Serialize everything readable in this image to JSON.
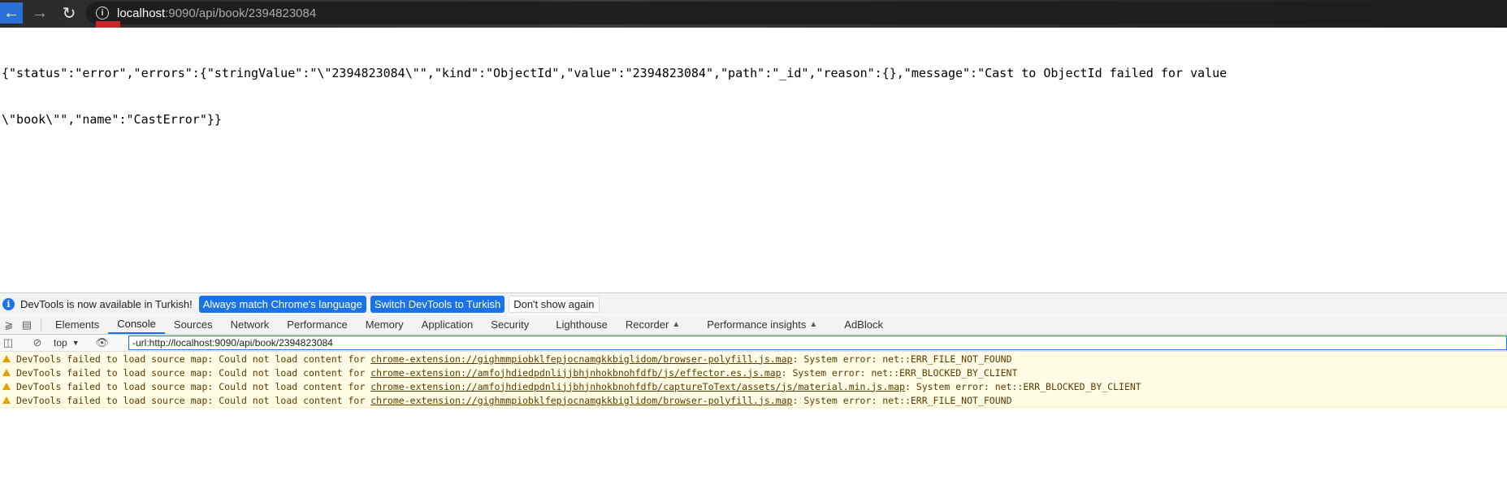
{
  "browser": {
    "url_host": "localhost",
    "url_rest": ":9090/api/book/2394823084"
  },
  "page": {
    "json_line1": "{\"status\":\"error\",\"errors\":{\"stringValue\":\"\\\"2394823084\\\"\",\"kind\":\"ObjectId\",\"value\":\"2394823084\",\"path\":\"_id\",\"reason\":{},\"message\":\"Cast to ObjectId failed for value",
    "json_line2": "\\\"book\\\"\",\"name\":\"CastError\"}}"
  },
  "devtools": {
    "infobar": {
      "message": "DevTools is now available in Turkish!",
      "match_button": "Always match Chrome's language",
      "switch_button": "Switch DevTools to Turkish",
      "dismiss_button": "Don't show again"
    },
    "tabs": [
      "Elements",
      "Console",
      "Sources",
      "Network",
      "Performance",
      "Memory",
      "Application",
      "Security",
      "Lighthouse",
      "Recorder",
      "Performance insights",
      "AdBlock"
    ],
    "active_tab": "Console",
    "console": {
      "context": "top",
      "filter_value": "-url:http://localhost:9090/api/book/2394823084"
    },
    "messages": [
      {
        "prefix": "DevTools failed to load source map: Could not load content for ",
        "link": "chrome-extension://gighmmpiobklfepjocnamgkkbiglidom/browser-polyfill.js.map",
        "suffix": ": System error: net::ERR_FILE_NOT_FOUND"
      },
      {
        "prefix": "DevTools failed to load source map: Could not load content for ",
        "link": "chrome-extension://amfojhdiedpdnlijjbhjnhokbnohfdfb/js/effector.es.js.map",
        "suffix": ": System error: net::ERR_BLOCKED_BY_CLIENT"
      },
      {
        "prefix": "DevTools failed to load source map: Could not load content for ",
        "link": "chrome-extension://amfojhdiedpdnlijjbhjnhokbnohfdfb/captureToText/assets/js/material.min.js.map",
        "suffix": ": System error: net::ERR_BLOCKED_BY_CLIENT"
      },
      {
        "prefix": "DevTools failed to load source map: Could not load content for ",
        "link": "chrome-extension://gighmmpiobklfepjocnamgkkbiglidom/browser-polyfill.js.map",
        "suffix": ": System error: net::ERR_FILE_NOT_FOUND"
      }
    ]
  }
}
